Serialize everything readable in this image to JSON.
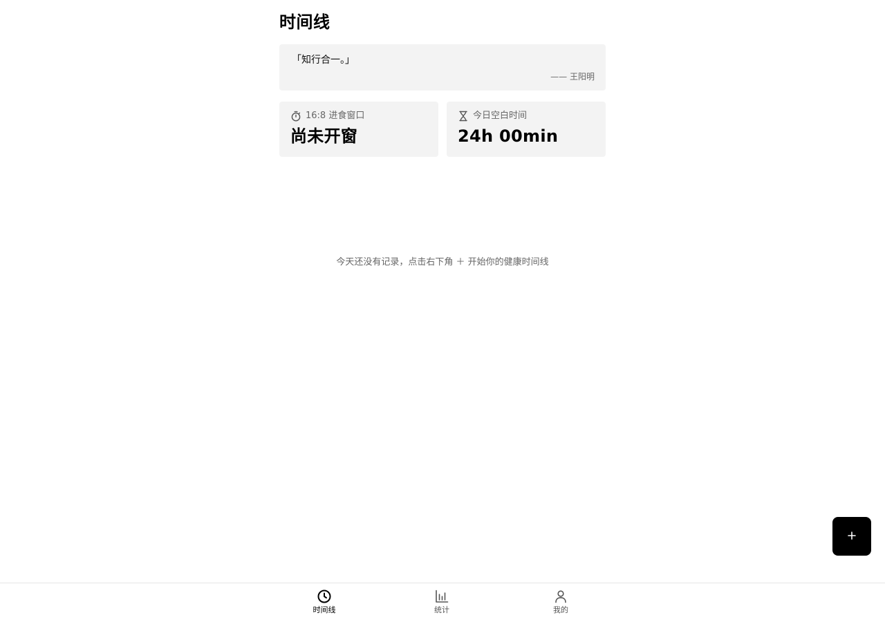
{
  "header": {
    "title": "时间线"
  },
  "quote": {
    "text": "「知行合一。」",
    "author": "—— 王阳明"
  },
  "stats": {
    "fasting": {
      "icon": "stopwatch-icon",
      "label": "16:8 进食窗口",
      "value": "尚未开窗"
    },
    "blank_time": {
      "icon": "hourglass-icon",
      "label": "今日空白时间",
      "value": "24h 00min"
    }
  },
  "empty_state": {
    "text": "今天还没有记录，点击右下角 ＋ 开始你的健康时间线"
  },
  "fab": {
    "icon": "plus-icon"
  },
  "bottom_nav": {
    "items": [
      {
        "label": "时间线",
        "icon": "clock-icon",
        "active": true
      },
      {
        "label": "统计",
        "icon": "bar-chart-icon",
        "active": false
      },
      {
        "label": "我的",
        "icon": "user-icon",
        "active": false
      }
    ]
  },
  "colors": {
    "card_bg": "#f3f3f3",
    "primary": "#000000",
    "muted_text": "#666666"
  }
}
